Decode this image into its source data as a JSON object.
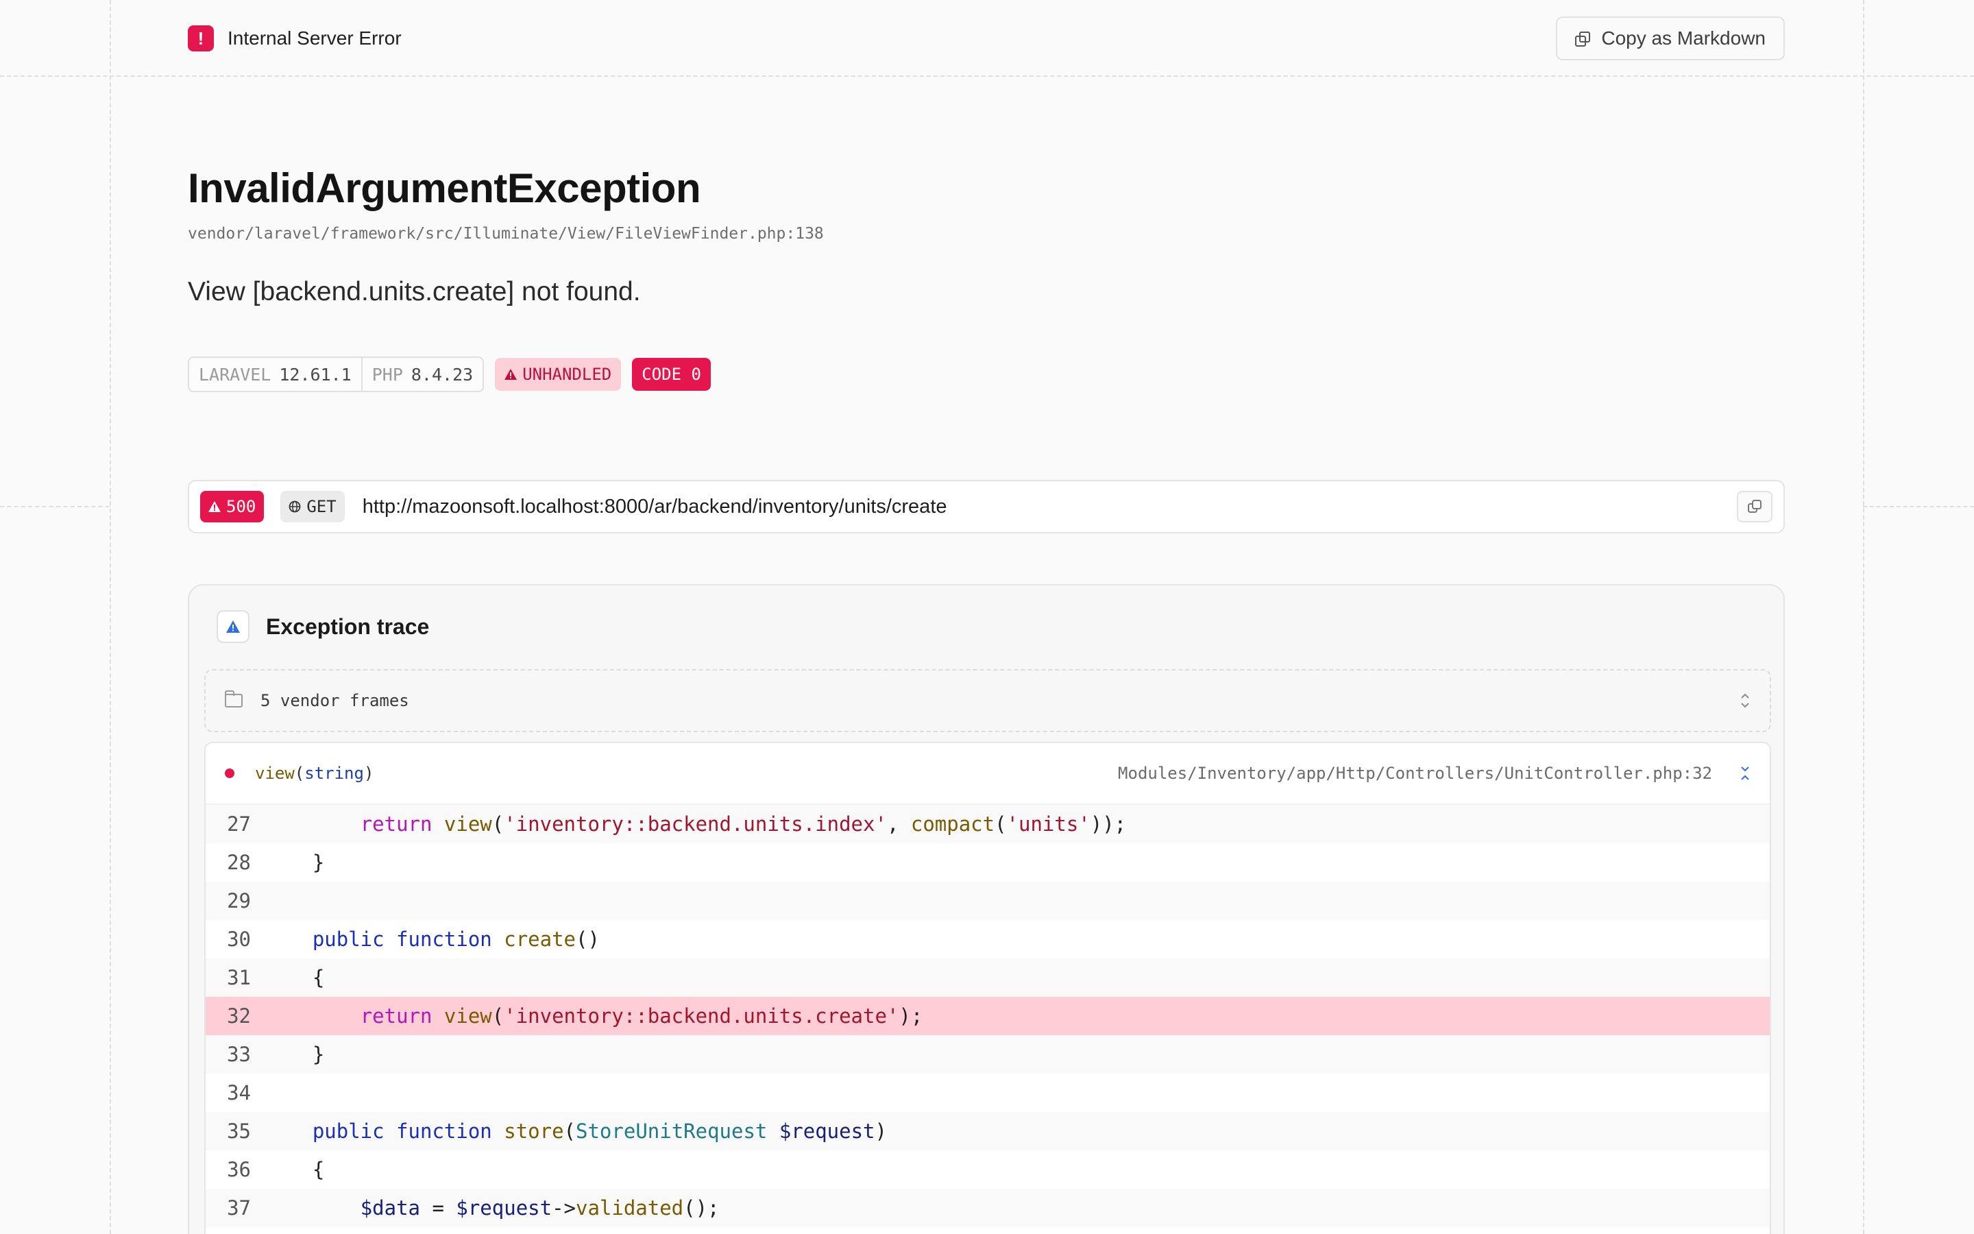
{
  "header": {
    "title": "Internal Server Error",
    "error_glyph": "!",
    "copy_markdown_label": "Copy as Markdown"
  },
  "exception": {
    "class": "InvalidArgumentException",
    "file": "vendor/laravel/framework/src/Illuminate/View/FileViewFinder.php:138",
    "message": "View [backend.units.create] not found."
  },
  "badges": {
    "laravel_key": "LARAVEL",
    "laravel_version": "12.61.1",
    "php_key": "PHP",
    "php_version": "8.4.23",
    "unhandled": "UNHANDLED",
    "code": "CODE 0"
  },
  "request": {
    "status": "500",
    "method": "GET",
    "url": "http://mazoonsoft.localhost:8000/ar/backend/inventory/units/create"
  },
  "trace": {
    "title": "Exception trace",
    "vendor_frames_label": "5 vendor frames",
    "frame": {
      "function": "view",
      "arg": "string",
      "path": "Modules/Inventory/app/Http/Controllers/UnitController.php:32"
    },
    "lines": [
      {
        "n": "27"
      },
      {
        "n": "28"
      },
      {
        "n": "29"
      },
      {
        "n": "30"
      },
      {
        "n": "31"
      },
      {
        "n": "32"
      },
      {
        "n": "33"
      },
      {
        "n": "34"
      },
      {
        "n": "35"
      },
      {
        "n": "36"
      },
      {
        "n": "37"
      }
    ],
    "code": {
      "l27_kw": "return",
      "l27_fn": "view",
      "l27_str1": "'inventory::backend.units.index'",
      "l27_fn2": "compact",
      "l27_str2": "'units'",
      "l30_kw1": "public",
      "l30_kw2": "function",
      "l30_fn": "create",
      "l32_kw": "return",
      "l32_fn": "view",
      "l32_str": "'inventory::backend.units.create'",
      "l35_kw1": "public",
      "l35_kw2": "function",
      "l35_fn": "store",
      "l35_cls": "StoreUnitRequest",
      "l35_var": "$request",
      "l37_var1": "$data",
      "l37_var2": "$request",
      "l37_fn": "validated"
    }
  },
  "colors": {
    "accent_red": "#e5164d",
    "highlight_line": "#ffcdd6",
    "link_blue": "#2f6fe0"
  },
  "icons": [
    "error-icon",
    "copy-icon",
    "warning-icon",
    "globe-icon",
    "folder-icon",
    "chevron-updown-icon",
    "collapse-icon"
  ]
}
